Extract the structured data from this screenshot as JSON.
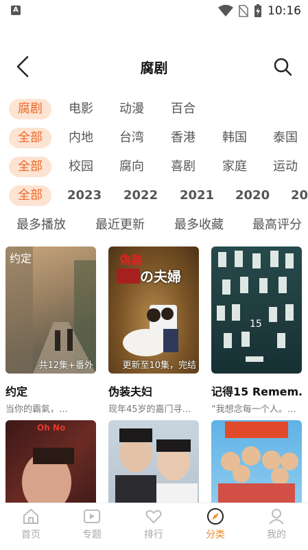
{
  "status": {
    "time": "10:16",
    "app_icon": "A"
  },
  "header": {
    "title": "腐剧"
  },
  "filters": {
    "row1": [
      "腐剧",
      "电影",
      "动漫",
      "百合"
    ],
    "row2": [
      "全部",
      "内地",
      "台湾",
      "香港",
      "韩国",
      "泰国"
    ],
    "row3": [
      "全部",
      "校园",
      "腐向",
      "喜剧",
      "家庭",
      "运动"
    ],
    "row4": [
      "全部",
      "2023",
      "2022",
      "2021",
      "2020",
      "20"
    ]
  },
  "sort": [
    "最多播放",
    "最近更新",
    "最多收藏",
    "最高评分"
  ],
  "cards": [
    {
      "title": "约定",
      "subtitle": "当你的霸氣，…",
      "badge": "共12集+番外",
      "poster_text": "约定"
    },
    {
      "title": "伪装夫妇",
      "subtitle": "现年45岁的嘉门寻…",
      "badge": "更新至10集，完结",
      "poster_text_top": "偽装",
      "poster_text_main": "の夫婦"
    },
    {
      "title": "记得15 Remem…",
      "subtitle": "“我想念每一个人。…",
      "badge": "",
      "poster_text": "15"
    },
    {
      "title": "",
      "subtitle": "",
      "badge": "",
      "poster_text": "Oh No"
    },
    {
      "title": "",
      "subtitle": "",
      "badge": "",
      "poster_text": ""
    },
    {
      "title": "",
      "subtitle": "",
      "badge": "",
      "poster_text": ""
    }
  ],
  "tabs": [
    {
      "label": "首页",
      "icon": "home-icon"
    },
    {
      "label": "专题",
      "icon": "play-box-icon"
    },
    {
      "label": "排行",
      "icon": "heart-icon"
    },
    {
      "label": "分类",
      "icon": "compass-icon"
    },
    {
      "label": "我的",
      "icon": "user-icon"
    }
  ],
  "colors": {
    "accent": "#ee6a2a",
    "chip_bg": "#fde3d2",
    "tab_active": "#ee8a2a"
  }
}
